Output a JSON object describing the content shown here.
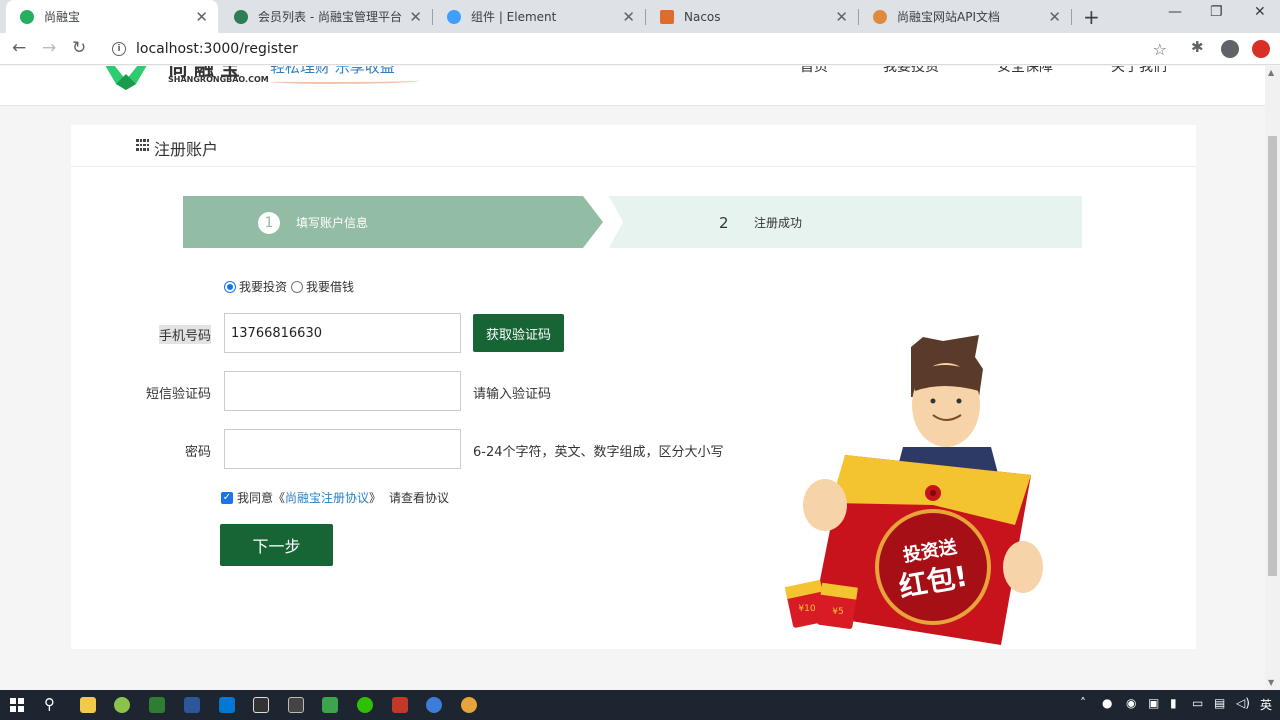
{
  "browser": {
    "tabs": [
      {
        "title": "尚融宝",
        "active": true,
        "favicon_color": "#27ae60"
      },
      {
        "title": "会员列表 - 尚融宝管理平台",
        "active": false,
        "favicon_color": "#2e7d55"
      },
      {
        "title": "组件 | Element",
        "active": false,
        "favicon_color": "#409eff"
      },
      {
        "title": "Nacos",
        "active": false,
        "favicon_color": "#e06c2c"
      },
      {
        "title": "尚融宝网站API文档",
        "active": false,
        "favicon_color": "#e08a3c"
      }
    ],
    "new_tab": "+",
    "url": "localhost:3000/register"
  },
  "site": {
    "logo_cn": "尚融宝",
    "logo_en": "SHANGRONGBAO.COM",
    "slogan": "轻松理财 乐享收益",
    "nav": [
      "首页",
      "我要投资",
      "安全保障",
      "关于我们"
    ]
  },
  "register": {
    "title": "注册账户",
    "steps": [
      {
        "num": "1",
        "label": "填写账户信息"
      },
      {
        "num": "2",
        "label": "注册成功"
      }
    ],
    "user_type": {
      "invest": "我要投资",
      "borrow": "我要借钱",
      "selected": "invest"
    },
    "phone": {
      "label": "手机号码",
      "value": "13766816630"
    },
    "get_code_button": "获取验证码",
    "sms": {
      "label": "短信验证码",
      "value": "",
      "hint": "请输入验证码"
    },
    "password": {
      "label": "密码",
      "value": "",
      "hint": "6-24个字符，英文、数字组成，区分大小写"
    },
    "agreement": {
      "checked": true,
      "prefix": "我同意《",
      "link": "尚融宝注册协议",
      "suffix": "》",
      "view": "请查看协议"
    },
    "next_button": "下一步"
  },
  "promo": {
    "envelope_text_1": "投资送",
    "envelope_text_2": "红包!",
    "coupon_1": "¥10",
    "coupon_2": "¥5"
  },
  "taskbar": {
    "ime": "英"
  }
}
